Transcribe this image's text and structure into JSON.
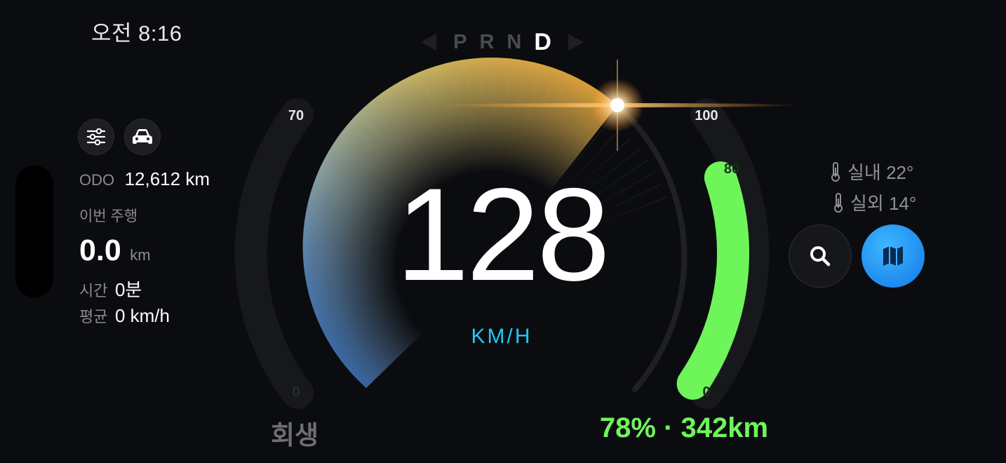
{
  "status": {
    "time": "오전 8:16"
  },
  "gear": {
    "letters": [
      "P",
      "R",
      "N",
      "D"
    ],
    "active": "D"
  },
  "trip": {
    "odo_label": "ODO",
    "odo_value": "12,612 km",
    "current_trip_label": "이번 주행",
    "distance_value": "0.0",
    "distance_unit": "km",
    "time_label": "시간",
    "time_value": "0분",
    "avg_label": "평균",
    "avg_value": "0 km/h"
  },
  "speedometer": {
    "speed": "128",
    "unit": "KM/H",
    "left_gauge": {
      "top_label": "70",
      "bottom_label": "0",
      "caption": "회생"
    },
    "right_gauge": {
      "top_label": "100",
      "level_label": "80",
      "bottom_label": "0",
      "battery_percent": 78,
      "caption": "78% · 342km"
    }
  },
  "climate": {
    "inside_label": "실내 22°",
    "outside_label": "실외 14°"
  },
  "colors": {
    "accent_blue": "#22c8f0",
    "battery_green": "#6ef55a",
    "map_button": "#1a8cf5",
    "background": "#0b0c10"
  },
  "icons": {
    "settings": "sliders-icon",
    "car": "car-icon",
    "thermometer": "thermometer-icon",
    "search": "search-icon",
    "map": "map-icon"
  }
}
